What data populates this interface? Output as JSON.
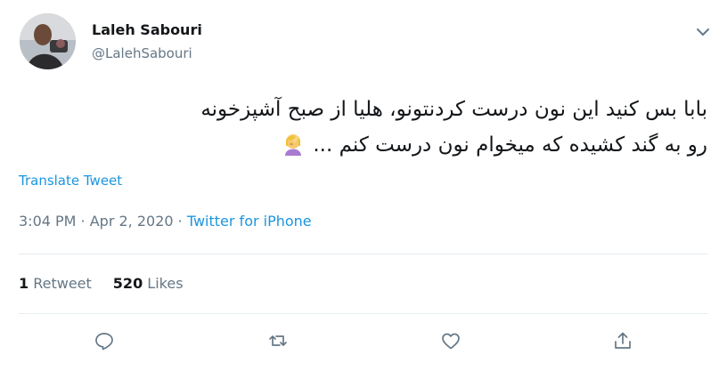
{
  "author": {
    "name": "Laleh Sabouri",
    "handle": "@LalehSabouri"
  },
  "tweet": {
    "text_line1": "بابا بس کنید این نون درست کردنتونو، هلیا از صبح آشپزخونه",
    "text_line2": "رو به گند کشیده که میخوام نون درست کنم ...",
    "emoji": "🤦‍♀️"
  },
  "translate_label": "Translate Tweet",
  "meta": {
    "time": "3:04 PM",
    "separator1": " · ",
    "date": "Apr 2, 2020",
    "separator2": " · ",
    "source": "Twitter for iPhone"
  },
  "stats": {
    "retweets_count": "1",
    "retweets_label": "Retweet",
    "likes_count": "520",
    "likes_label": "Likes"
  },
  "icons": {
    "reply": "reply-icon",
    "retweet": "retweet-icon",
    "like": "like-icon",
    "share": "share-icon",
    "more": "chevron-down-icon"
  },
  "colors": {
    "link": "#1b95e0",
    "secondary_text": "#657786",
    "border": "#e6ecf0"
  }
}
